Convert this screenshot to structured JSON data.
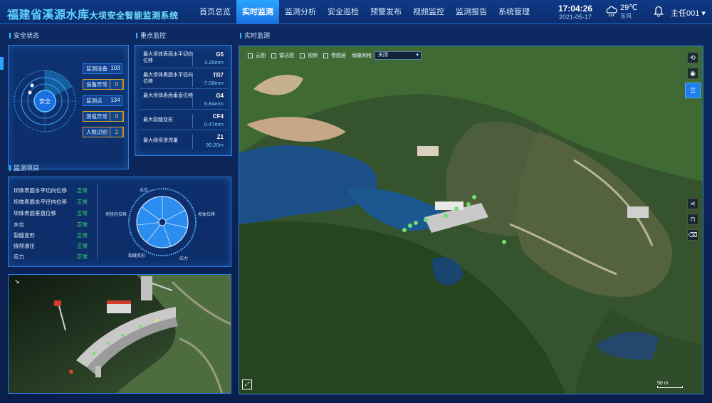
{
  "header": {
    "title": "福建省溪源水库",
    "subtitle": "大坝安全智能监测系统",
    "nav": [
      "首页总览",
      "实时监测",
      "监测分析",
      "安全巡检",
      "预警发布",
      "视频监控",
      "监测报告",
      "系统管理"
    ],
    "active_tab": 1,
    "time": "17:04:26",
    "date": "2021-05-17",
    "temperature": "29℃",
    "wind": "东风",
    "user": "主任001"
  },
  "safety": {
    "title": "安全状态",
    "center_label": "安全",
    "items": [
      {
        "label": "监测设备",
        "value": "103",
        "status": "normal"
      },
      {
        "label": "设备异常",
        "value": "0",
        "status": "warn"
      },
      {
        "label": "监测点",
        "value": "134",
        "status": "normal"
      },
      {
        "label": "测值异常",
        "value": "0",
        "status": "warn"
      },
      {
        "label": "人数识别",
        "value": "2",
        "status": "warn"
      }
    ]
  },
  "key_monitor": {
    "title": "重点监控",
    "rows": [
      {
        "label": "最大坝体表面水平切向位移",
        "code": "G5",
        "value": "3.26mm"
      },
      {
        "label": "最大坝体表面水平径向位移",
        "code": "TR7",
        "value": "-7.08mm"
      },
      {
        "label": "最大坝体表面垂直位移",
        "code": "G4",
        "value": "6.84mm"
      },
      {
        "label": "最大裂缝变形",
        "code": "CF4",
        "value": "0.47mm"
      },
      {
        "label": "最大绕坝渗流量",
        "code": "Z1",
        "value": "90.20m"
      }
    ]
  },
  "monitor_items": {
    "title": "监测项目",
    "rows": [
      {
        "label": "坝体表面水平切向位移",
        "status": "正常"
      },
      {
        "label": "坝体表面水平径向位移",
        "status": "正常"
      },
      {
        "label": "坝体表面垂直位移",
        "status": "正常"
      },
      {
        "label": "水位",
        "status": "正常"
      },
      {
        "label": "裂缝变形",
        "status": "正常"
      },
      {
        "label": "绕坝渗压",
        "status": "正常"
      },
      {
        "label": "应力",
        "status": "正常"
      }
    ],
    "wheel_labels": {
      "top": "水位",
      "left": "坝径向位移",
      "right": "坝体位移",
      "bottom_left": "裂缝变形",
      "bottom_right": "应力"
    }
  },
  "map": {
    "title": "实时监测",
    "layers": [
      "云图",
      "雷达图",
      "视频",
      "卷图层"
    ],
    "dropdown_label": "雨量网格",
    "dropdown_value": "关闭",
    "scale": "50 m"
  },
  "colors": {
    "accent": "#1e7ff0",
    "ok": "#3de06f",
    "warn": "#d9a320"
  }
}
